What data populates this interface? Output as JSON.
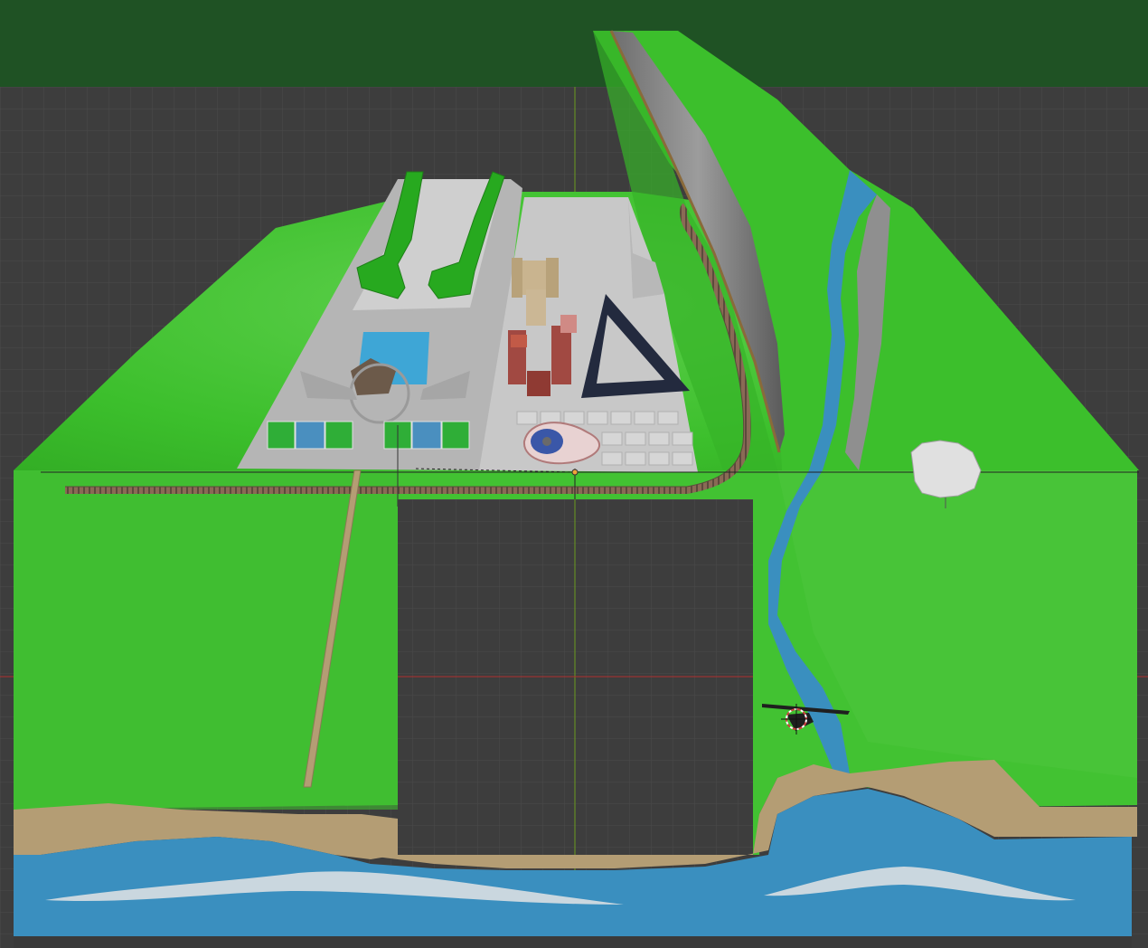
{
  "viewport": {
    "background_color": "#3d3d3d",
    "grid_color": "#4a4a4a",
    "header_color": "#1f5224",
    "x_axis_color": "#b03030",
    "y_axis_color": "#6a9a1f"
  },
  "scene": {
    "terrain_color": "#3cbf2c",
    "terrain_light": "#62d050",
    "terrain_dark": "#279a1e",
    "water_color": "#3a8fbf",
    "sand_color": "#b49d74",
    "concrete_color": "#bfbfbf",
    "track_color": "#8a6a55",
    "objects": [
      "platform-left",
      "platform-right",
      "hedge-left",
      "hedge-right",
      "pool",
      "pavilion",
      "sports-court",
      "castle",
      "red-buildings",
      "triangle-building",
      "fountain-plaza",
      "parking-grid",
      "railway",
      "ridge",
      "river",
      "stone-disc",
      "pier",
      "empty-plane",
      "beach",
      "sea",
      "surf-foam",
      "drone",
      "3d-cursor"
    ]
  }
}
